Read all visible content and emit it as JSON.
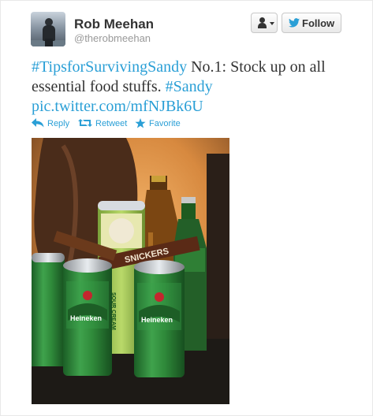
{
  "user": {
    "name": "Rob Meehan",
    "handle": "@therobmeehan"
  },
  "buttons": {
    "user_menu_icon": "user-icon",
    "follow_label": "Follow",
    "follow_icon": "twitter-bird-icon"
  },
  "tweet": {
    "hashtag_1": "#TipsforSurvivingSandy",
    "text_1": " No.1: Stock up on all essential food stuffs. ",
    "hashtag_2": "#Sandy",
    "link": "pic.twitter.com/mfNJBk6U"
  },
  "actions": {
    "reply": "Reply",
    "retweet": "Retweet",
    "favorite": "Favorite"
  },
  "photo": {
    "can_1_text": "Heineken",
    "can_2_text": "Heineken",
    "snack_text": "SOUR CREAM",
    "candy_text": "SNICKERS",
    "colors": {
      "wall": "#e49a52",
      "can_green": "#2f8a3a",
      "link_blue": "#2a9fd6"
    }
  }
}
